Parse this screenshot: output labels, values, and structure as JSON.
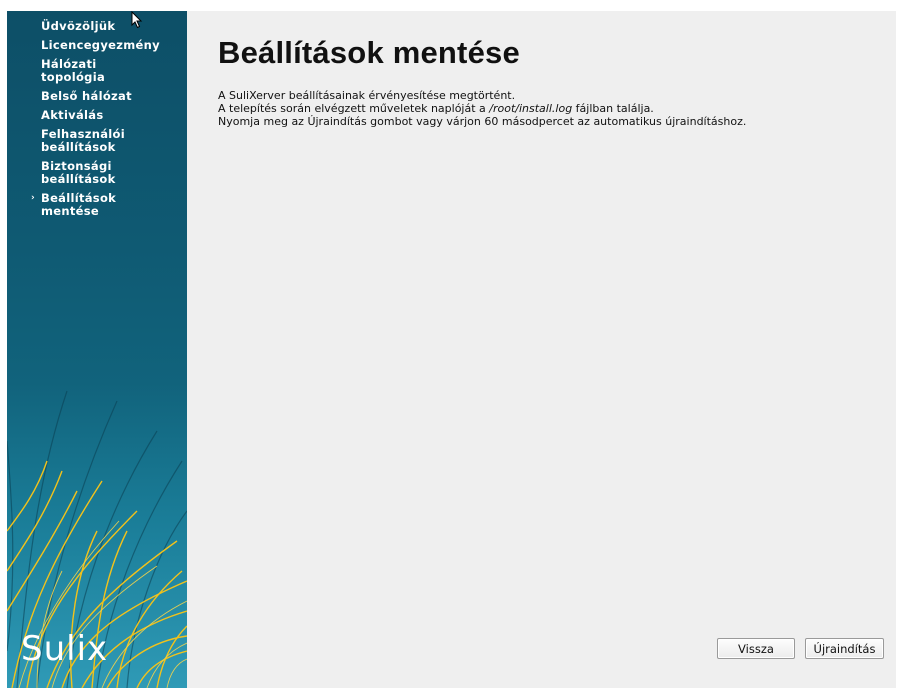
{
  "sidebar": {
    "items": [
      {
        "label": "Üdvözöljük"
      },
      {
        "label": "Licencegyezmény"
      },
      {
        "label": "Hálózati topológia"
      },
      {
        "label": "Belső hálózat"
      },
      {
        "label": "Aktiválás"
      },
      {
        "label": "Felhasználói beállítások"
      },
      {
        "label": "Biztonsági beállítások"
      },
      {
        "label": "Beállítások mentése",
        "current": true
      }
    ],
    "current_marker": "›",
    "logo_text": "Sulix"
  },
  "main": {
    "title": "Beállítások mentése",
    "line1": "A SuliXerver beállításainak érvényesítése megtörtént.",
    "line2_before": "A telepítés során elvégzett műveletek naplóját a ",
    "line2_path": "/root/install.log",
    "line2_after": " fájlban találja.",
    "line3": "Nyomja meg az Újraindítás gombot vagy várjon 60 másodpercet az automatikus újraindításhoz."
  },
  "buttons": {
    "back": "Vissza",
    "reboot": "Újraindítás"
  },
  "colors": {
    "sidebar": "#0f5a73",
    "background": "#efefef",
    "grass": "#f2c21b"
  }
}
